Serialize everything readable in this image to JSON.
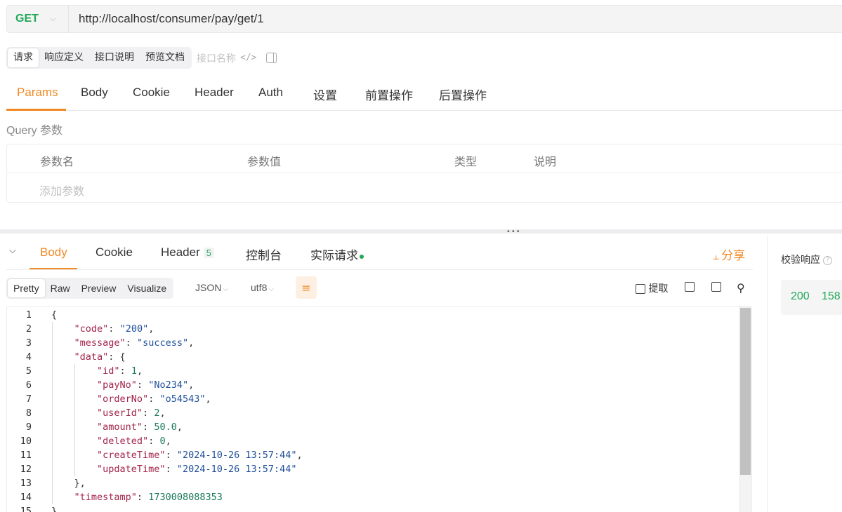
{
  "request": {
    "method": "GET",
    "url": "http://localhost/consumer/pay/get/1"
  },
  "doc_tabs": [
    "请求",
    "响应定义",
    "接口说明",
    "预览文档"
  ],
  "interface_name_placeholder": "接口名称",
  "request_tabs": [
    "Params",
    "Body",
    "Cookie",
    "Header",
    "Auth",
    "设置",
    "前置操作",
    "后置操作"
  ],
  "query": {
    "title": "Query 参数",
    "columns": [
      "参数名",
      "参数值",
      "类型",
      "说明"
    ],
    "add_placeholder": "添加参数"
  },
  "response": {
    "tabs": {
      "body": "Body",
      "cookie": "Cookie",
      "header": "Header",
      "header_count": "5",
      "console": "控制台",
      "actual": "实际请求"
    },
    "share": "分享",
    "formats": [
      "Pretty",
      "Raw",
      "Preview",
      "Visualize"
    ],
    "language": "JSON",
    "encoding": "utf8",
    "extract": "提取",
    "status": "200",
    "time": "158"
  },
  "validate_label": "校验响应",
  "colors": {
    "accent": "#f08a24",
    "success": "#22a85a",
    "json_key": "#a3254b",
    "json_string": "#1f4f9a",
    "json_number": "#1b7a5a"
  },
  "code_lines": [
    {
      "n": "1",
      "text": "{"
    },
    {
      "n": "2",
      "text": "    \"code\": \"200\","
    },
    {
      "n": "3",
      "text": "    \"message\": \"success\","
    },
    {
      "n": "4",
      "text": "    \"data\": {"
    },
    {
      "n": "5",
      "text": "        \"id\": 1,"
    },
    {
      "n": "6",
      "text": "        \"payNo\": \"No234\","
    },
    {
      "n": "7",
      "text": "        \"orderNo\": \"o54543\","
    },
    {
      "n": "8",
      "text": "        \"userId\": 2,"
    },
    {
      "n": "9",
      "text": "        \"amount\": 50.0,"
    },
    {
      "n": "10",
      "text": "        \"deleted\": 0,"
    },
    {
      "n": "11",
      "text": "        \"createTime\": \"2024-10-26 13:57:44\","
    },
    {
      "n": "12",
      "text": "        \"updateTime\": \"2024-10-26 13:57:44\""
    },
    {
      "n": "13",
      "text": "    },"
    },
    {
      "n": "14",
      "text": "    \"timestamp\": 1730008088353"
    },
    {
      "n": "15",
      "text": "}"
    }
  ]
}
